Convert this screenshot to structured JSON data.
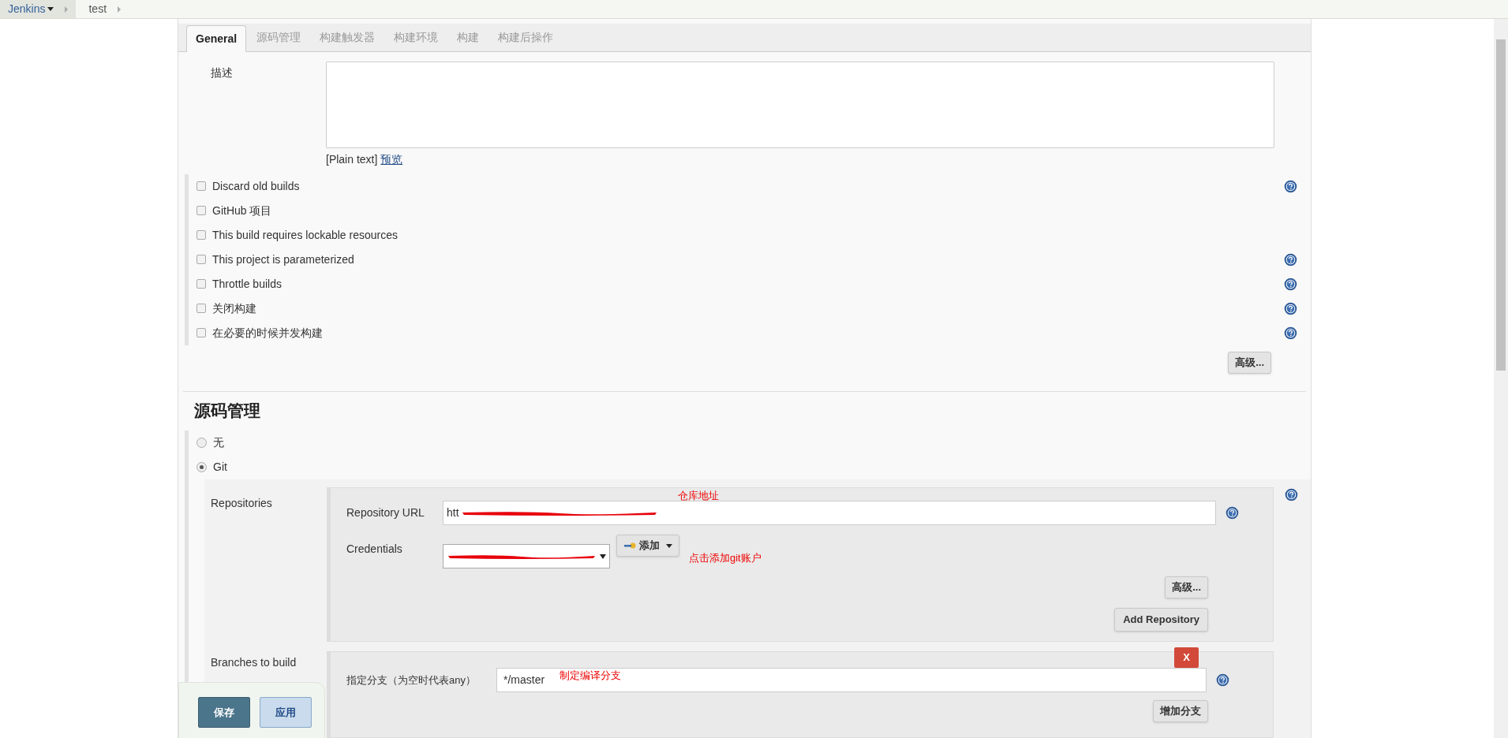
{
  "breadcrumbs": [
    {
      "label": "Jenkins",
      "dropdown": true
    },
    {
      "label": "test",
      "dropdown": false
    }
  ],
  "tabs": [
    {
      "label": "General",
      "selected": true
    },
    {
      "label": "源码管理",
      "selected": false
    },
    {
      "label": "构建触发器",
      "selected": false
    },
    {
      "label": "构建环境",
      "selected": false
    },
    {
      "label": "构建",
      "selected": false
    },
    {
      "label": "构建后操作",
      "selected": false
    }
  ],
  "description": {
    "label": "描述",
    "format": "[Plain text]",
    "preview_link": "预览"
  },
  "options": [
    {
      "label": "Discard old builds",
      "checked": false,
      "help": true
    },
    {
      "label": "GitHub 项目",
      "checked": false,
      "help": false
    },
    {
      "label": "This build requires lockable resources",
      "checked": false,
      "help": false
    },
    {
      "label": "This project is parameterized",
      "checked": false,
      "help": true
    },
    {
      "label": "Throttle builds",
      "checked": false,
      "help": true
    },
    {
      "label": "关闭构建",
      "checked": false,
      "help": true
    },
    {
      "label": "在必要的时候并发构建",
      "checked": false,
      "help": true
    }
  ],
  "advanced_button": "高级...",
  "scm": {
    "heading": "源码管理",
    "options": [
      {
        "label": "无",
        "selected": false
      },
      {
        "label": "Git",
        "selected": true
      }
    ],
    "repositories": {
      "label": "Repositories",
      "url_label": "Repository URL",
      "url_value": "htt",
      "url_note": "仓库地址",
      "credentials_label": "Credentials",
      "add_button": "添加",
      "credentials_note": "点击添加git账户",
      "advanced_button": "高级...",
      "add_repository_button": "Add Repository"
    },
    "branches": {
      "label": "Branches to build",
      "delete_button": "X",
      "spec_label": "指定分支（为空时代表any）",
      "spec_value": "*/master",
      "spec_note": "制定编译分支",
      "add_branch_button": "增加分支"
    }
  },
  "actions": [
    {
      "label": "保存",
      "kind": "primary"
    },
    {
      "label": "应用",
      "kind": "secondary"
    }
  ]
}
